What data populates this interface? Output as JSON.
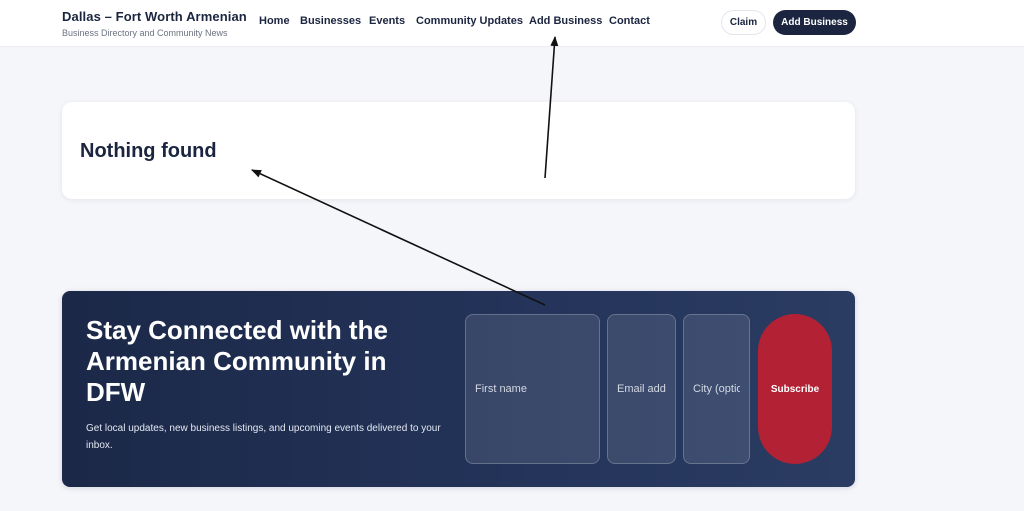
{
  "header": {
    "brand_title": "Dallas – Fort Worth Armenian",
    "brand_subtitle": "Business Directory and Community News",
    "nav": [
      {
        "label": "Home"
      },
      {
        "label": "Businesses"
      },
      {
        "label": "Events"
      },
      {
        "label": "Community Updates"
      },
      {
        "label": "Add Business"
      },
      {
        "label": "Contact"
      }
    ],
    "claim_label": "Claim",
    "add_business_label": "Add Business"
  },
  "main": {
    "message": "Nothing found"
  },
  "newsletter": {
    "title": "Stay Connected with the Armenian Community in DFW",
    "description": "Get local updates, new business listings, and upcoming events delivered to your inbox.",
    "first_name_placeholder": "First name",
    "email_placeholder": "Email address",
    "city_placeholder": "City (optional)",
    "subscribe_label": "Subscribe"
  },
  "colors": {
    "brand_navy": "#1b2540",
    "subscribe_red": "#b22234",
    "page_background": "#f5f6fa"
  }
}
